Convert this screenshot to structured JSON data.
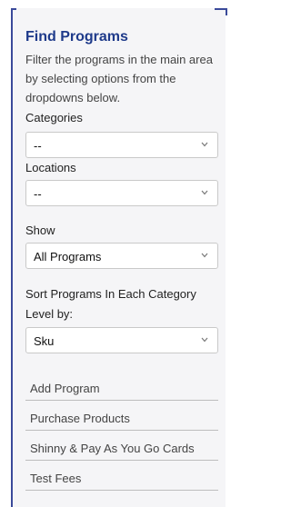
{
  "panel": {
    "title": "Find Programs",
    "description": "Filter the programs in the main area by selecting options from the dropdowns below."
  },
  "filters": {
    "categories": {
      "label": "Categories",
      "value": "--"
    },
    "locations": {
      "label": "Locations",
      "value": "--"
    },
    "show": {
      "label": "Show",
      "value": "All Programs"
    },
    "sort": {
      "label_line1": "Sort Programs In Each Category",
      "label_line2": "Level by:",
      "value": "Sku"
    }
  },
  "links": [
    "Add Program",
    "Purchase Products",
    "Shinny & Pay As You Go Cards",
    "Test Fees"
  ],
  "colors": {
    "accent": "#1e3a8a",
    "panel_bg": "#f5f5f7",
    "border": "#3a4a9a"
  }
}
